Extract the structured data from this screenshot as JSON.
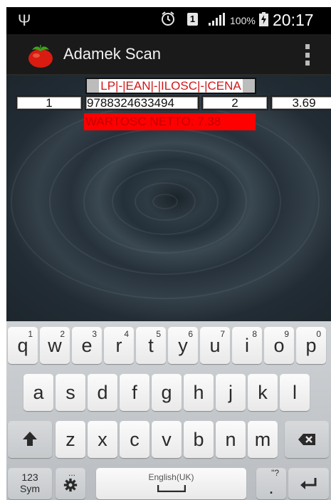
{
  "status_bar": {
    "usb_icon": "usb-icon",
    "alarm_icon": "alarm-clock-icon",
    "sim_label": "1",
    "signal_icon": "signal-bars-icon",
    "battery_percent": "100%",
    "battery_icon": "battery-charging-icon",
    "time": "20:17"
  },
  "action_bar": {
    "app_icon": "tomato-icon",
    "title": "Adamek Scan",
    "overflow_icon": "overflow-menu-icon"
  },
  "table": {
    "header": "LP|-|EAN|-|ILOSC|-|CENA",
    "rows": [
      {
        "lp": "1",
        "ean": "9788324633494",
        "ilosc": "2",
        "cena": "3.69"
      }
    ],
    "total": "WARTOSC NETTO: 7.38"
  },
  "keyboard": {
    "row1": [
      {
        "key": "q",
        "sup": "1"
      },
      {
        "key": "w",
        "sup": "2"
      },
      {
        "key": "e",
        "sup": "3"
      },
      {
        "key": "r",
        "sup": "4"
      },
      {
        "key": "t",
        "sup": "5"
      },
      {
        "key": "y",
        "sup": "6"
      },
      {
        "key": "u",
        "sup": "7"
      },
      {
        "key": "i",
        "sup": "8"
      },
      {
        "key": "o",
        "sup": "9"
      },
      {
        "key": "p",
        "sup": "0"
      }
    ],
    "row2": [
      "a",
      "s",
      "d",
      "f",
      "g",
      "h",
      "j",
      "k",
      "l"
    ],
    "row3": [
      "z",
      "x",
      "c",
      "v",
      "b",
      "n",
      "m"
    ],
    "shift_icon": "shift-arrow-icon",
    "backspace_icon": "backspace-icon",
    "sym_label_1": "123",
    "sym_label_2": "Sym",
    "settings_icon": "gear-icon",
    "settings_sup": "...",
    "space_label": "English(UK)",
    "period_key": ".",
    "period_sup": "\"?",
    "enter_icon": "enter-icon",
    "colors": {
      "key_bg": "#f5f5f5",
      "keyboard_bg": "#c4c7ca",
      "accent_red": "#ff0000"
    }
  }
}
